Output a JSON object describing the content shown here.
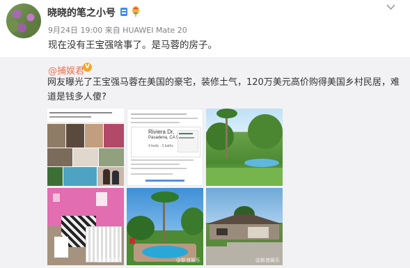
{
  "post": {
    "author": "晓晓的笔之小号",
    "meta": "9月24日 19:00 来自 HUAWEI Mate 20",
    "text": "现在没有王宝强啥事了。是马蓉的房子。"
  },
  "repost": {
    "author": "@捕娱君",
    "text": "网友曝光了王宝强马蓉在美国的豪宅，装修土气，120万美元高价购得美国乡村民居，难道是钱多人傻?"
  },
  "images": {
    "card": {
      "address_line1": "Riviera Dr,",
      "address_line2": "Pasadena, CA 91107",
      "stats": "4 beds · 3 baths"
    },
    "watermark": "@新浪娱乐"
  },
  "icons": {
    "chevron": "chevron-down-icon",
    "badges": [
      "vip-badge-icon",
      "balloon-badge-icon"
    ],
    "verified": "verified-v-icon"
  }
}
